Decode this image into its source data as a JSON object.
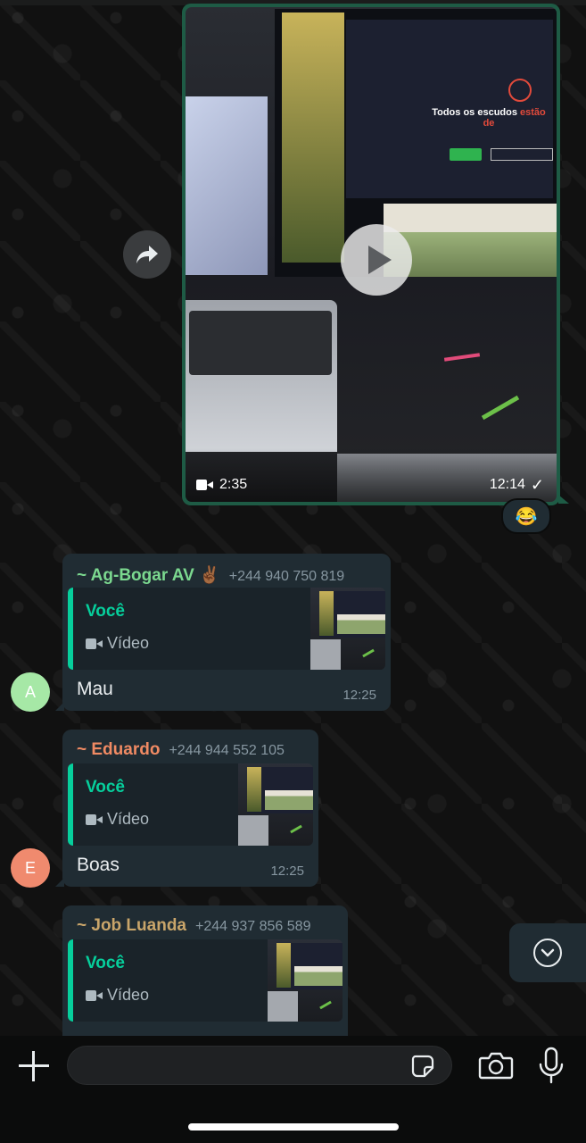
{
  "video_message": {
    "duration": "2:35",
    "time": "12:14",
    "status_icon": "single-check-icon",
    "reaction": "😂",
    "preview_title_main": "Todos os escudos ",
    "preview_title_accent": "estão de"
  },
  "messages": [
    {
      "sender": "~ Ag-Bogar AV ✌🏾",
      "phone": "+244 940 750 819",
      "sender_color": "#7bd88f",
      "quote_author": "Você",
      "quote_type": "Vídeo",
      "text": "Mau",
      "time": "12:25",
      "avatar_letter": "A",
      "avatar_color": "#a6e8a6"
    },
    {
      "sender": "~ Eduardo",
      "phone": "+244 944 552 105",
      "sender_color": "#f08a63",
      "quote_author": "Você",
      "quote_type": "Vídeo",
      "text": "Boas",
      "time": "12:25",
      "avatar_letter": "E",
      "avatar_color": "#f08a6e"
    },
    {
      "sender": "~ Job Luanda",
      "phone": "+244 937 856 589",
      "sender_color": "#c9a56a",
      "quote_author": "Você",
      "quote_type": "Vídeo",
      "text": "",
      "time": ""
    }
  ],
  "composer": {
    "placeholder": "",
    "icons": [
      "plus-icon",
      "sticker-icon",
      "camera-icon",
      "microphone-icon"
    ]
  },
  "scroll_button_icon": "chevron-down-icon"
}
